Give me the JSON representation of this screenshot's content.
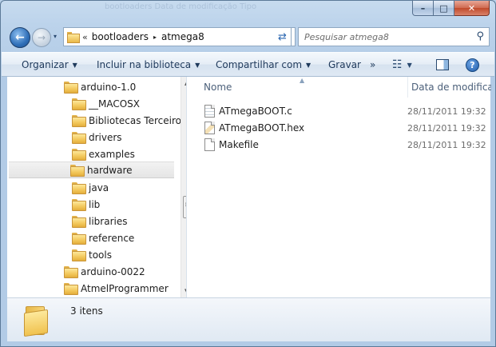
{
  "window": {
    "ghost_title": "bootloaders   Data de modificação   Tipo",
    "caption": {
      "minimize": "–",
      "maximize": "□",
      "close": "✕"
    }
  },
  "nav": {
    "back_glyph": "←",
    "forward_glyph": "→",
    "history_glyph": "▾",
    "address": {
      "overflow": "«",
      "crumbs": [
        "bootloaders",
        "atmega8"
      ],
      "separator": "▸",
      "dropdown": "▾"
    },
    "refresh_glyph": "⇄",
    "search_placeholder": "Pesquisar atmega8"
  },
  "toolbar": {
    "organize": "Organizar",
    "include_library": "Incluir na biblioteca",
    "share": "Compartilhar com",
    "burn": "Gravar",
    "more": "»",
    "dropdown": "▼",
    "view_icon": "☷",
    "help": "?"
  },
  "tree": {
    "items": [
      {
        "label": "arduino-1.0"
      },
      {
        "label": "__MACOSX"
      },
      {
        "label": "Bibliotecas Terceiros"
      },
      {
        "label": "drivers"
      },
      {
        "label": "examples"
      },
      {
        "label": "hardware"
      },
      {
        "label": "java"
      },
      {
        "label": "lib"
      },
      {
        "label": "libraries"
      },
      {
        "label": "reference"
      },
      {
        "label": "tools"
      },
      {
        "label": "arduino-0022"
      },
      {
        "label": "AtmelProgrammer"
      }
    ]
  },
  "files": {
    "columns": {
      "name": "Nome",
      "date": "Data de modificaç"
    },
    "rows": [
      {
        "name": "ATmegaBOOT.c",
        "date": "28/11/2011 19:32"
      },
      {
        "name": "ATmegaBOOT.hex",
        "date": "28/11/2011 19:32"
      },
      {
        "name": "Makefile",
        "date": "28/11/2011 19:32"
      }
    ]
  },
  "status": {
    "count": "3 itens"
  }
}
